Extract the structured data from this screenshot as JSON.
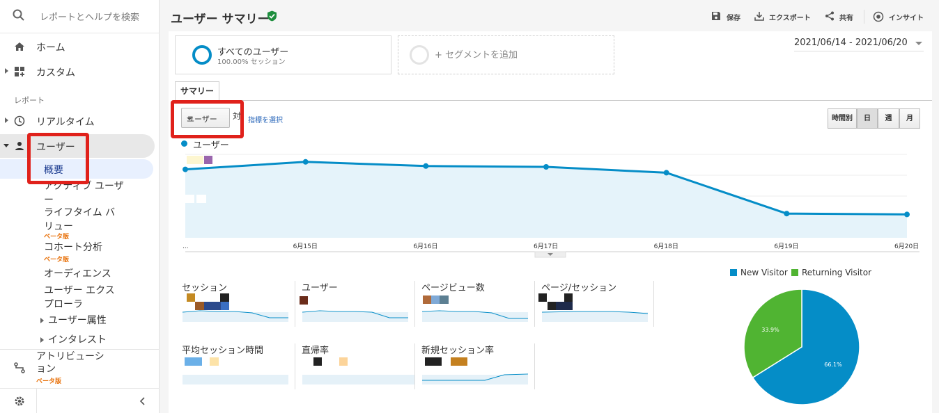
{
  "search": {
    "placeholder": "レポートとヘルプを検索"
  },
  "nav": {
    "home": "ホーム",
    "custom": "カスタム",
    "section_reports": "レポート",
    "realtime": "リアルタイム",
    "users": "ユーザー",
    "overview": "概要",
    "active_users": "アクティブ ユーザー",
    "lifetime_value": "ライフタイム バリュー",
    "cohort": "コホート分析",
    "audience": "オーディエンス",
    "user_explorer": "ユーザー エクスプローラ",
    "user_attributes": "ユーザー属性",
    "interests": "インタレスト",
    "attribution": "アトリビューション",
    "beta": "ベータ版"
  },
  "header": {
    "title": "ユーザー サマリー",
    "save": "保存",
    "export": "エクスポート",
    "share": "共有",
    "insight": "インサイト"
  },
  "segments": {
    "all_users": "すべてのユーザー",
    "all_users_sub": "100.00% セッション",
    "add_segment": "+ セグメントを追加"
  },
  "date_range": "2021/06/14 - 2021/06/20",
  "tabs": {
    "summary": "サマリー"
  },
  "controls": {
    "metric": "ユーザー",
    "vs": "対",
    "select_metric": "指標を選択",
    "periods": [
      "時間別",
      "日",
      "週",
      "月"
    ],
    "active_period": "日"
  },
  "chart_data": {
    "type": "area",
    "series": [
      {
        "name": "ユーザー",
        "values": [
          0.82,
          0.91,
          0.86,
          0.85,
          0.78,
          0.29,
          0.28
        ]
      }
    ],
    "x": [
      "...",
      "6月15日",
      "6月16日",
      "6月17日",
      "6月18日",
      "6月19日",
      "6月20日"
    ],
    "color": "#058dc7"
  },
  "metrics": {
    "sessions": "セッション",
    "users": "ユーザー",
    "pageviews": "ページビュー数",
    "pages_per_session": "ページ/セッション",
    "avg_session_duration": "平均セッション時間",
    "bounce_rate": "直帰率",
    "new_session_rate": "新規セッション率"
  },
  "pie": {
    "legend": [
      "New Visitor",
      "Returning Visitor"
    ],
    "colors": [
      "#058dc7",
      "#50b432"
    ],
    "values": [
      66.1,
      33.9
    ],
    "labels": [
      "66.1%",
      "33.9%"
    ]
  }
}
